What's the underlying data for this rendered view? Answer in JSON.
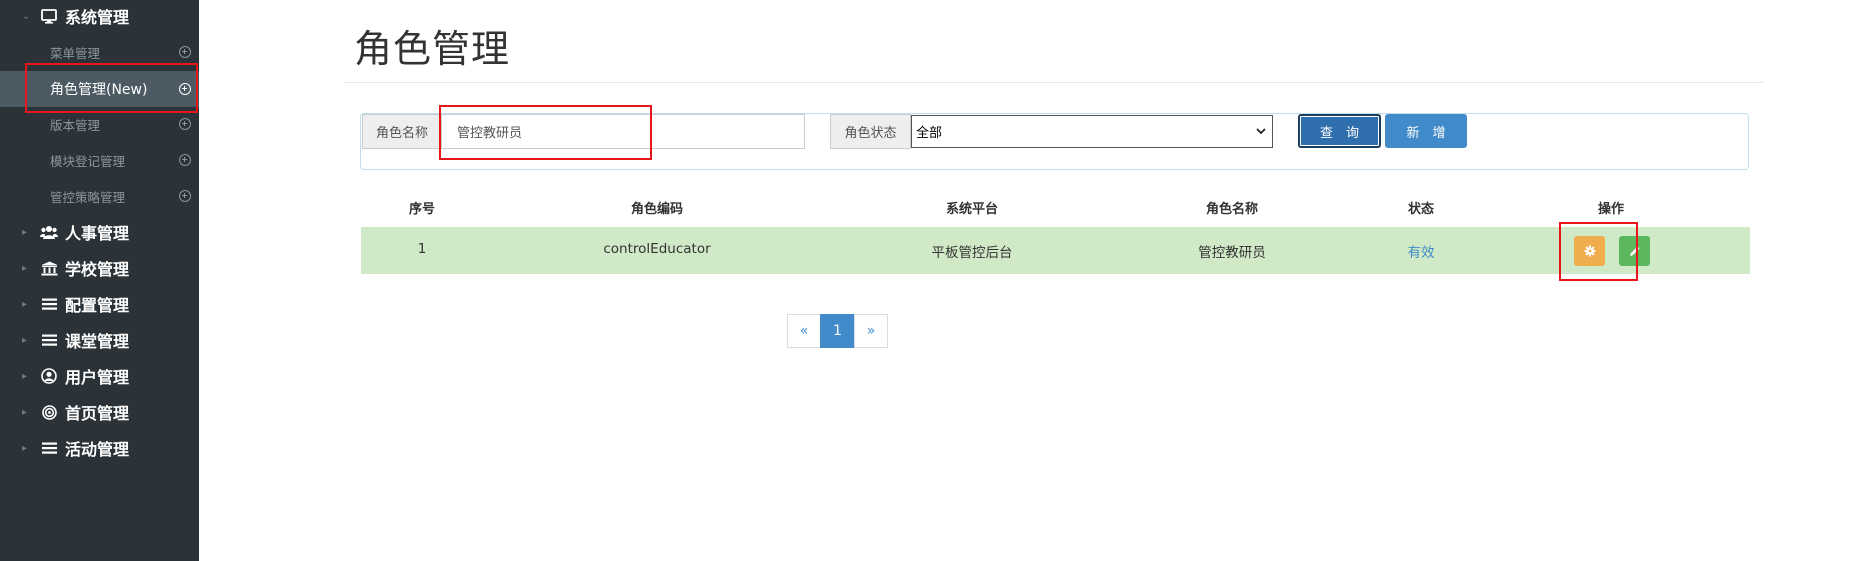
{
  "sidebar": {
    "system_group": {
      "label": "系统管理",
      "icon": "monitor-icon"
    },
    "sub_items": [
      {
        "label": "菜单管理"
      },
      {
        "label": "角色管理(New)",
        "active": true
      },
      {
        "label": "版本管理"
      },
      {
        "label": "模块登记管理"
      },
      {
        "label": "管控策略管理"
      }
    ],
    "groups": [
      {
        "label": "人事管理",
        "icon": "users-icon"
      },
      {
        "label": "学校管理",
        "icon": "institution-icon"
      },
      {
        "label": "配置管理",
        "icon": "list-icon"
      },
      {
        "label": "课堂管理",
        "icon": "list-icon"
      },
      {
        "label": "用户管理",
        "icon": "user-circle-icon"
      },
      {
        "label": "首页管理",
        "icon": "bullseye-icon"
      },
      {
        "label": "活动管理",
        "icon": "list-icon"
      }
    ]
  },
  "page": {
    "title": "角色管理"
  },
  "filter": {
    "role_name_label": "角色名称",
    "role_name_value": "管控教研员",
    "role_status_label": "角色状态",
    "role_status_selected": "全部",
    "query_button": "查　询",
    "add_button": "新　增"
  },
  "table": {
    "headers": [
      "序号",
      "角色编码",
      "系统平台",
      "角色名称",
      "状态",
      "操作"
    ],
    "rows": [
      {
        "index": "1",
        "code": "controlEducator",
        "platform": "平板管控后台",
        "name": "管控教研员",
        "status": "有效"
      }
    ]
  },
  "pagination": {
    "prev": "«",
    "current": "1",
    "next": "»"
  },
  "colors": {
    "sidebar_bg": "#2b3338",
    "active_item_bg": "#4b5a63",
    "primary": "#428bca",
    "warning": "#f0ad4e",
    "success": "#5cb85c",
    "row_highlight": "#d0e9c6",
    "annotation_red": "#e8151b"
  }
}
